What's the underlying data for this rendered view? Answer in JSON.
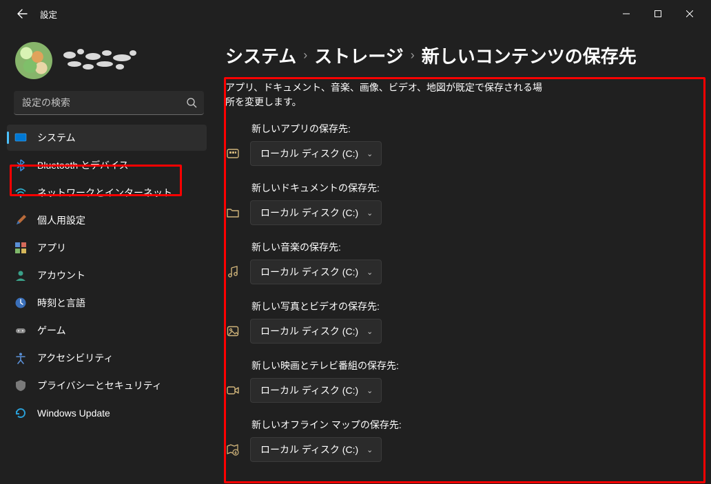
{
  "title": "設定",
  "search_placeholder": "設定の検索",
  "sidebar": {
    "items": [
      {
        "label": "システム"
      },
      {
        "label": "Bluetooth とデバイス"
      },
      {
        "label": "ネットワークとインターネット"
      },
      {
        "label": "個人用設定"
      },
      {
        "label": "アプリ"
      },
      {
        "label": "アカウント"
      },
      {
        "label": "時刻と言語"
      },
      {
        "label": "ゲーム"
      },
      {
        "label": "アクセシビリティ"
      },
      {
        "label": "プライバシーとセキュリティ"
      },
      {
        "label": "Windows Update"
      }
    ]
  },
  "breadcrumb": {
    "a": "システム",
    "b": "ストレージ",
    "c": "新しいコンテンツの保存先"
  },
  "description": "アプリ、ドキュメント、音楽、画像、ビデオ、地図が既定で保存される場所を変更します。",
  "default_value": "ローカル ディスク (C:)",
  "settings": [
    {
      "label": "新しいアプリの保存先:"
    },
    {
      "label": "新しいドキュメントの保存先:"
    },
    {
      "label": "新しい音楽の保存先:"
    },
    {
      "label": "新しい写真とビデオの保存先:"
    },
    {
      "label": "新しい映画とテレビ番組の保存先:"
    },
    {
      "label": "新しいオフライン マップの保存先:"
    }
  ]
}
